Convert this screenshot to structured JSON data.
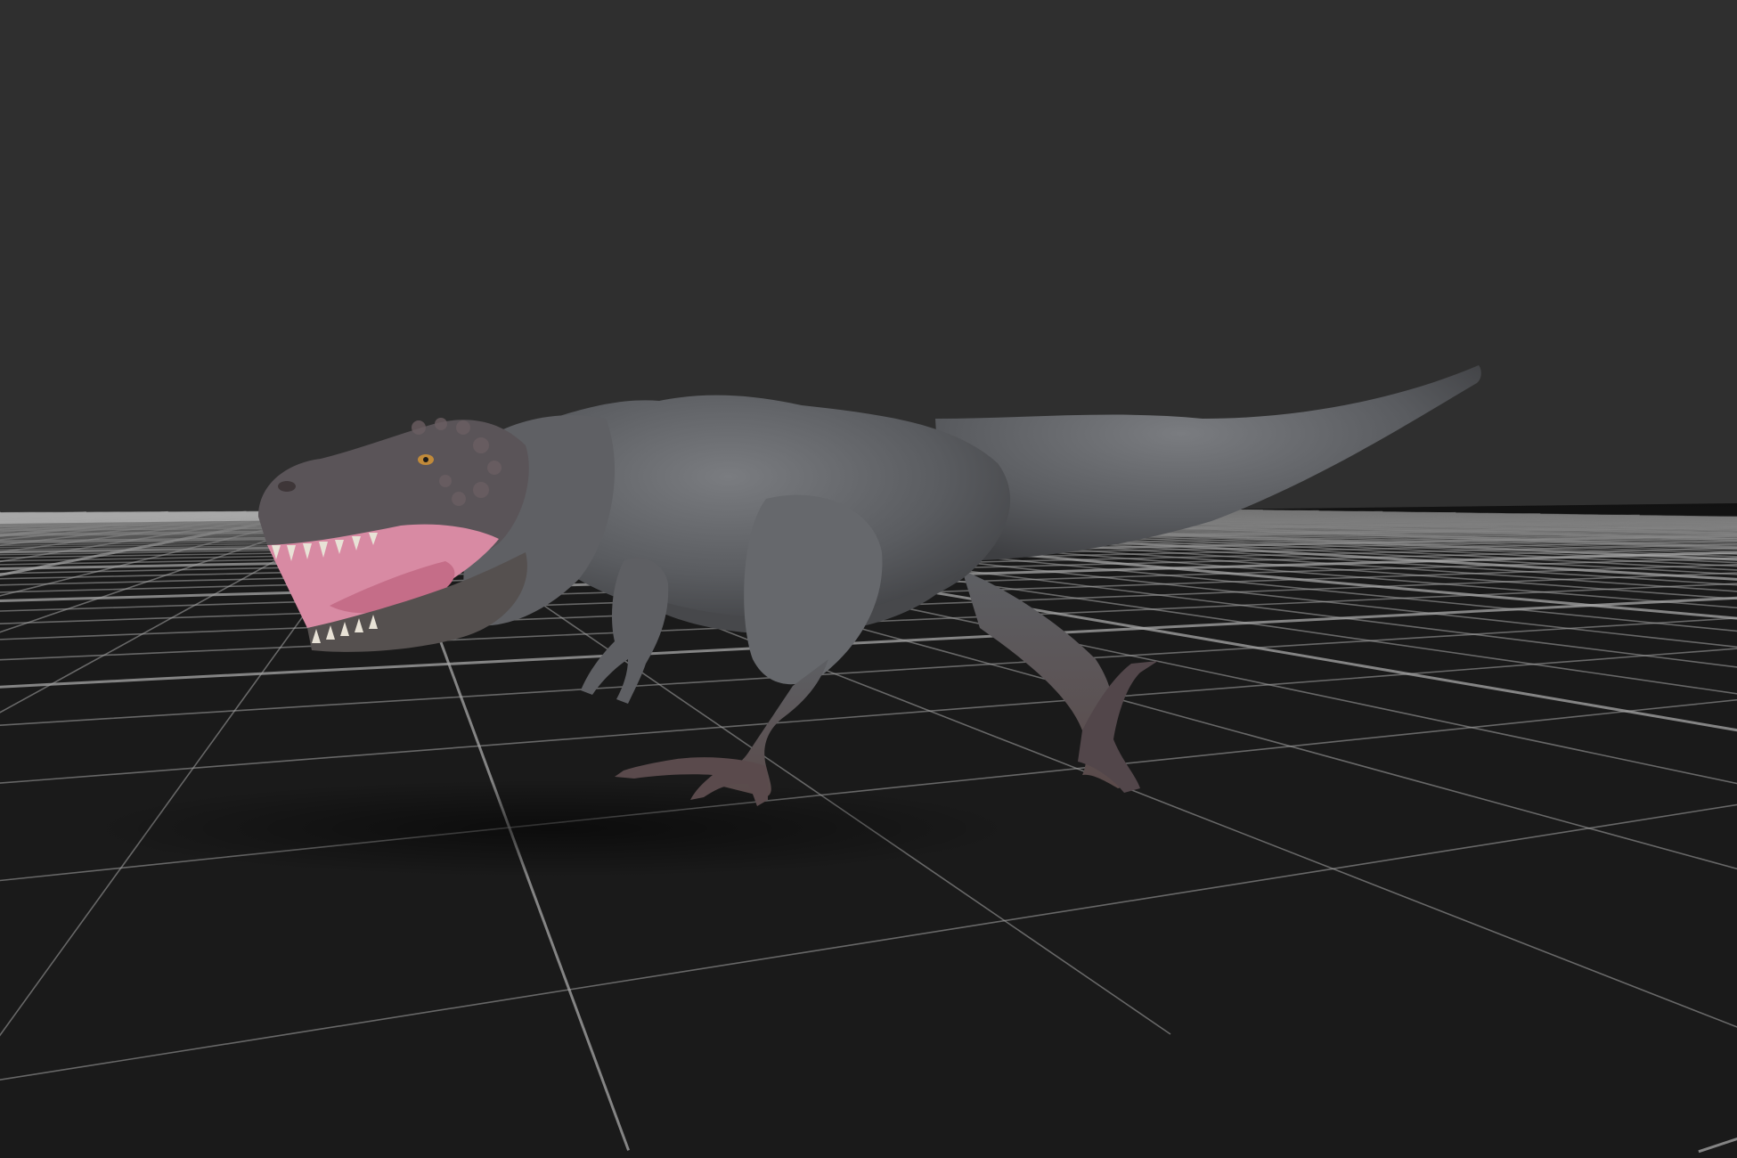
{
  "viewport": {
    "background": "#2f2f2f",
    "grid_floor_color": "#191919",
    "grid_line_color": "#a8a8a8"
  },
  "model": {
    "icon": "tyrannosaurus-model-icon",
    "skin_color": "#5c5e62",
    "mouth_color": "#d88aa3"
  }
}
